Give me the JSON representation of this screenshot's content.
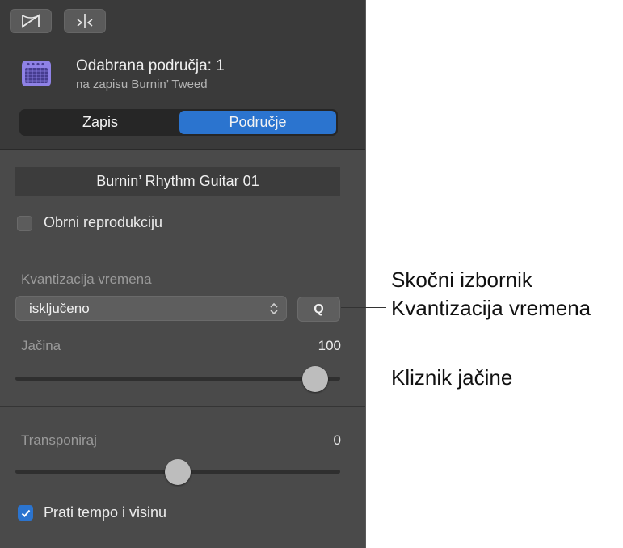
{
  "toolbar": {
    "left_icon": "bowtie-icon",
    "right_icon": "split-icon"
  },
  "header": {
    "icon": "amp-icon",
    "title": "Odabrana područja: 1",
    "subtitle": "na zapisu Burnin’ Tweed"
  },
  "segmented": {
    "left_label": "Zapis",
    "right_label": "Područje",
    "selected": "Područje",
    "accent_color": "#2b74cf"
  },
  "region": {
    "name": "Burnin’ Rhythm Guitar 01",
    "reverse_label": "Obrni reprodukciju",
    "reverse_checked": false
  },
  "quantize": {
    "label": "Kvantizacija vremena",
    "value": "isključeno",
    "q_button": "Q"
  },
  "volume": {
    "label": "Jačina",
    "value": "100",
    "level": 0.96
  },
  "transpose": {
    "label": "Transponiraj",
    "value": "0",
    "level": 0.5
  },
  "follow": {
    "label": "Prati tempo i visinu",
    "checked": true
  },
  "callouts": {
    "quantize_line1": "Skočni izbornik",
    "quantize_line2": "Kvantizacija vremena",
    "volume": "Kliznik jačine"
  }
}
